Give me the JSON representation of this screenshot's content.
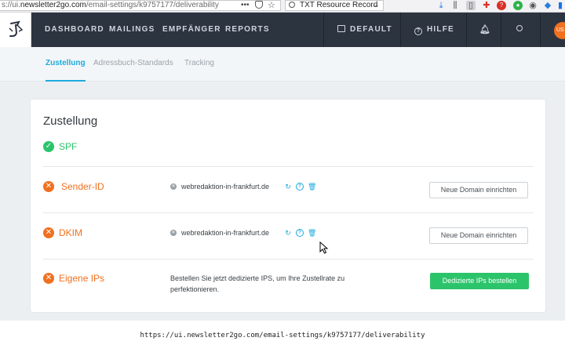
{
  "browser": {
    "url_prefix": "s://ui.",
    "url_host": "newsletter2go.com",
    "url_path": "/email-settings/k9757177/deliverability",
    "url_dots": "•••",
    "search_text": "TXT Resource Record",
    "search_arrow": "→"
  },
  "topnav": {
    "items": [
      {
        "label": "DASHBOARD"
      },
      {
        "label": "MAILINGS"
      },
      {
        "label": "EMPFÄNGER"
      },
      {
        "label": "REPORTS"
      }
    ],
    "account_label": "DEFAULT",
    "help_label": "HILFE",
    "avatar_text": "US"
  },
  "subnav": {
    "tabs": [
      {
        "label": "Zustellung",
        "active": true
      },
      {
        "label": "Adressbuch-Standards",
        "active": false
      },
      {
        "label": "Tracking",
        "active": false
      }
    ]
  },
  "card": {
    "title": "Zustellung",
    "rows": {
      "spf": {
        "label": "SPF",
        "status": "ok"
      },
      "sender_id": {
        "label": "Sender-ID",
        "status": "error",
        "domain": "webredaktion-in-frankfurt.de",
        "button": "Neue Domain einrichten"
      },
      "dkim": {
        "label": "DKIM",
        "status": "error",
        "domain": "webredaktion-in-frankfurt.de",
        "button": "Neue Domain einrichten"
      },
      "ips": {
        "label": "Eigene IPs",
        "status": "error",
        "description": "Bestellen Sie jetzt dedizierte IPS, um Ihre Zustellrate zu perfektionieren.",
        "button": "Dedizierte IPs bestellen"
      }
    }
  },
  "footer_url": "https://ui.newsletter2go.com/email-settings/k9757177/deliverability",
  "colors": {
    "nav_bg": "#2c3440",
    "accent_blue": "#1eaadc",
    "success_green": "#2cc46a",
    "error_orange": "#f07020"
  }
}
